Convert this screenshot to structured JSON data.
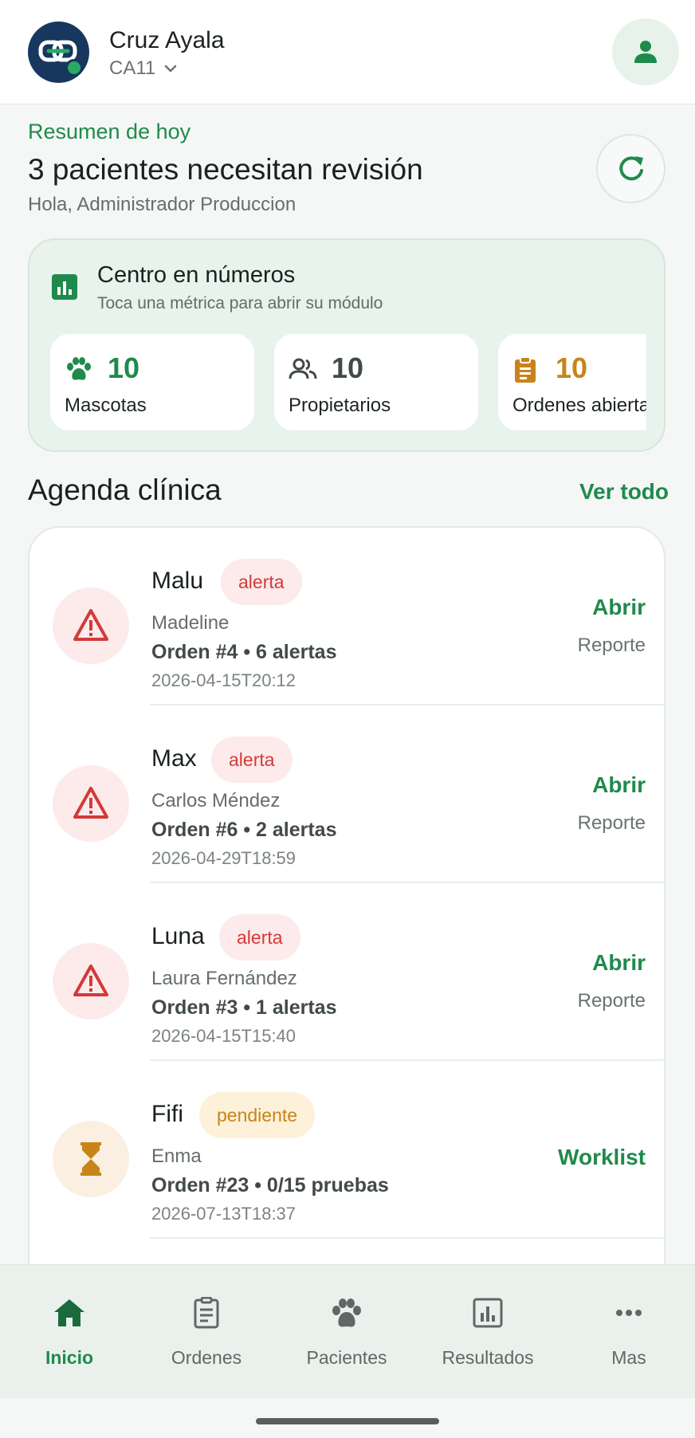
{
  "header": {
    "clinic_name": "Cruz Ayala",
    "clinic_code": "CA11"
  },
  "summary": {
    "label": "Resumen de hoy",
    "title": "3 pacientes necesitan revisión",
    "greeting": "Hola, Administrador Produccion"
  },
  "metrics": {
    "title": "Centro en números",
    "subtitle": "Toca una métrica para abrir su módulo",
    "items": [
      {
        "value": "10",
        "label": "Mascotas",
        "icon": "paw-icon",
        "color": "#1f8a4c"
      },
      {
        "value": "10",
        "label": "Propietarios",
        "icon": "people-icon",
        "color": "#424a47"
      },
      {
        "value": "10",
        "label": "Ordenes abiertas",
        "icon": "clipboard-icon",
        "color": "#c8841a"
      }
    ]
  },
  "agenda": {
    "title": "Agenda clínica",
    "see_all": "Ver todo",
    "rows": [
      {
        "pet": "Malu",
        "badge": "alerta",
        "badge_type": "alert",
        "owner": "Madeline",
        "order": "Orden #4 • 6 alertas",
        "date": "2026-04-15T20:12",
        "action": "Abrir",
        "sub_action": "Reporte",
        "icon": "warning-icon"
      },
      {
        "pet": "Max",
        "badge": "alerta",
        "badge_type": "alert",
        "owner": "Carlos Méndez",
        "order": "Orden #6 • 2 alertas",
        "date": "2026-04-29T18:59",
        "action": "Abrir",
        "sub_action": "Reporte",
        "icon": "warning-icon"
      },
      {
        "pet": "Luna",
        "badge": "alerta",
        "badge_type": "alert",
        "owner": "Laura Fernández",
        "order": "Orden #3 • 1 alertas",
        "date": "2026-04-15T15:40",
        "action": "Abrir",
        "sub_action": "Reporte",
        "icon": "warning-icon"
      },
      {
        "pet": "Fifi",
        "badge": "pendiente",
        "badge_type": "pending",
        "owner": "Enma",
        "order": "Orden #23 • 0/15 pruebas",
        "date": "2026-07-13T18:37",
        "action": "Worklist",
        "sub_action": "",
        "icon": "hourglass-icon"
      }
    ]
  },
  "nav": {
    "items": [
      {
        "label": "Inicio",
        "icon": "home-icon",
        "active": true
      },
      {
        "label": "Ordenes",
        "icon": "clipboard-icon",
        "active": false
      },
      {
        "label": "Pacientes",
        "icon": "paw-icon",
        "active": false
      },
      {
        "label": "Resultados",
        "icon": "chart-icon",
        "active": false
      },
      {
        "label": "Mas",
        "icon": "more-icon",
        "active": false
      }
    ]
  },
  "colors": {
    "accent": "#1f8a4c",
    "alert_red": "#d23a3a",
    "alert_bg": "#fdeaea",
    "pending_orange": "#c8841a",
    "pending_bg": "#fdf1d9",
    "brand_navy": "#17375e"
  }
}
